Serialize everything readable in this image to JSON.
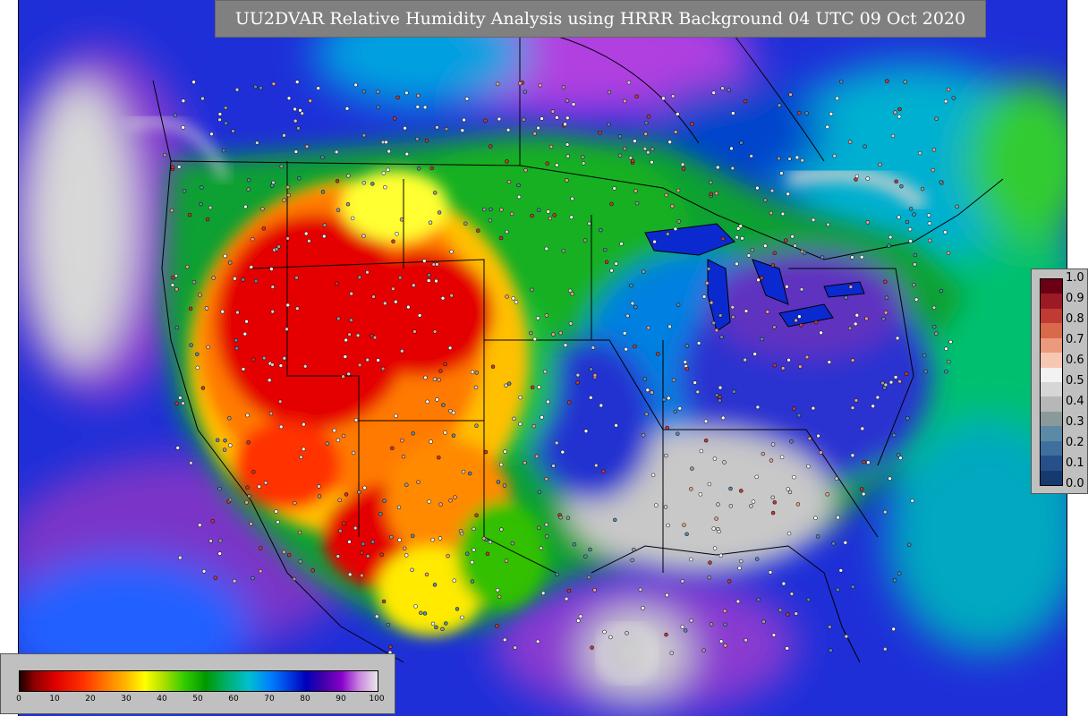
{
  "title": "UU2DVAR Relative Humidity Analysis using HRRR Background 04 UTC 09 Oct 2020",
  "obs_colorbar": {
    "ticks": [
      "1.0",
      "0.9",
      "0.8",
      "0.7",
      "0.6",
      "0.5",
      "0.4",
      "0.3",
      "0.2",
      "0.1",
      "0.0"
    ],
    "colors": [
      "#6b0015",
      "#9c1a25",
      "#c03b33",
      "#d9694b",
      "#ec9a7c",
      "#f6c8b4",
      "#f2f2f2",
      "#d6d6d6",
      "#b7b7b7",
      "#8a9a9a",
      "#5c8aa6",
      "#3f6f9f",
      "#27508a",
      "#163a70"
    ]
  },
  "rh_colorbar": {
    "ticks": [
      "0",
      "10",
      "20",
      "30",
      "40",
      "50",
      "60",
      "70",
      "80",
      "90",
      "100"
    ]
  },
  "map_layers": {
    "ocean_colors": [
      "#0a1fd0",
      "#1f7fff",
      "#7a2cc8",
      "#c9c9c9"
    ],
    "dry_colors": [
      "#e00000",
      "#ff6600",
      "#ffcc00",
      "#00b000"
    ]
  }
}
